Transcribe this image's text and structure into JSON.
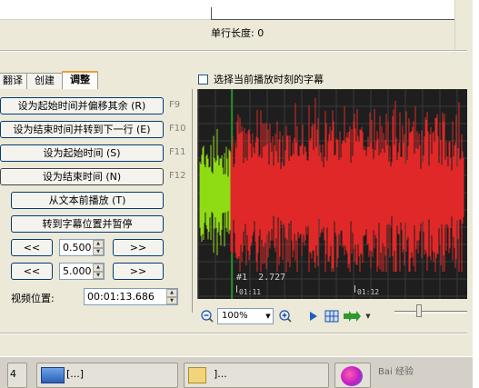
{
  "header": {
    "line_length_label": "单行长度: 0"
  },
  "tabs": [
    {
      "label": "翻译"
    },
    {
      "label": "创建"
    },
    {
      "label": "调整"
    }
  ],
  "adjust_panel": {
    "buttons": [
      {
        "label": "设为起始时间并偏移其余 (R)",
        "shortcut": "F9"
      },
      {
        "label": "设为结束时间并转到下一行 (E)",
        "shortcut": "F10"
      },
      {
        "label": "设为起始时间 (S)",
        "shortcut": "F11"
      },
      {
        "label": "设为结束时间 (N)",
        "shortcut": "F12"
      },
      {
        "label": "从文本前播放 (T)",
        "shortcut": ""
      },
      {
        "label": "转到字幕位置并暂停",
        "shortcut": ""
      }
    ],
    "step_rows": [
      {
        "back_label": "<<",
        "value": "0.500",
        "forward_label": ">>"
      },
      {
        "back_label": "<<",
        "value": "5.000",
        "forward_label": ">>"
      }
    ],
    "video_position_label": "视频位置:",
    "video_position_value": "00:01:13.686"
  },
  "waveform": {
    "checkbox_label": "选择当前播放时刻的字幕",
    "checkbox_checked": false,
    "subtitle_index": "#1",
    "subtitle_duration": "2.727",
    "time_ticks": [
      "01:11",
      "01:12"
    ],
    "colors": {
      "background": "#1e1e1e",
      "grid": "#3a3a3a",
      "selected_wave": "#8fdc14",
      "wave": "#e02828",
      "cursor": "#1faa1f"
    }
  },
  "wave_toolbar": {
    "zoom_value": "100%",
    "icons": [
      "zoom-out-icon",
      "zoom-in-icon",
      "play-icon",
      "grid-icon",
      "forward-arrows-icon"
    ]
  },
  "taskbar": {
    "items": [
      {
        "label": "4",
        "icon": "app-window-icon"
      },
      {
        "label": "[...]",
        "icon": "app-window-icon"
      },
      {
        "label": "]...",
        "icon": "folder-icon"
      },
      {
        "label": "",
        "icon": "browser-icon"
      }
    ],
    "watermark": "Bai 经验"
  }
}
